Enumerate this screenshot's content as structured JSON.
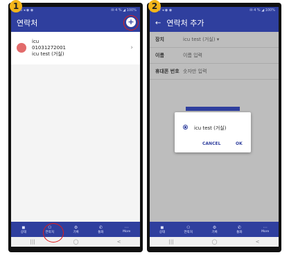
{
  "badges": [
    "1",
    "2"
  ],
  "screen1": {
    "status_left": "2:46 ◂ ◉ ◉",
    "status_right": "✉ 4 % ◢ 100%",
    "title": "연락처",
    "add_icon": "plus-icon",
    "contact": {
      "line1": "icu",
      "line2": "01031272001",
      "line3": "icu test (거실)"
    },
    "tabs": [
      {
        "icon": "◼",
        "label": "상태"
      },
      {
        "icon": "⚇",
        "label": "연락처"
      },
      {
        "icon": "⚙",
        "label": "기록"
      },
      {
        "icon": "✆",
        "label": "통화"
      },
      {
        "icon": "⋯",
        "label": "More"
      }
    ],
    "nav": [
      "|||",
      "◯",
      "<"
    ]
  },
  "screen2": {
    "status_left": "2:47 ◂ ◉ ◉",
    "status_right": "✉ 4 % ◢ 100%",
    "back_icon": "←",
    "title": "연락처 추가",
    "fields": [
      {
        "label": "장치",
        "value": "icu test (거실) ▾"
      },
      {
        "label": "이름",
        "value": "이름 입력"
      },
      {
        "label": "휴대폰 번호",
        "value": "숫자만 입력"
      }
    ],
    "dialog": {
      "option": "icu test (거실)",
      "cancel": "CANCEL",
      "ok": "OK"
    },
    "tabs": [
      {
        "icon": "◼",
        "label": "상태"
      },
      {
        "icon": "⚇",
        "label": "연락처"
      },
      {
        "icon": "⚙",
        "label": "기록"
      },
      {
        "icon": "✆",
        "label": "통화"
      },
      {
        "icon": "⋯",
        "label": "More"
      }
    ],
    "nav": [
      "|||",
      "◯",
      "<"
    ]
  },
  "colors": {
    "primary": "#2f3f9e",
    "highlight": "#e01b1b",
    "badge": "#f3b51a"
  }
}
